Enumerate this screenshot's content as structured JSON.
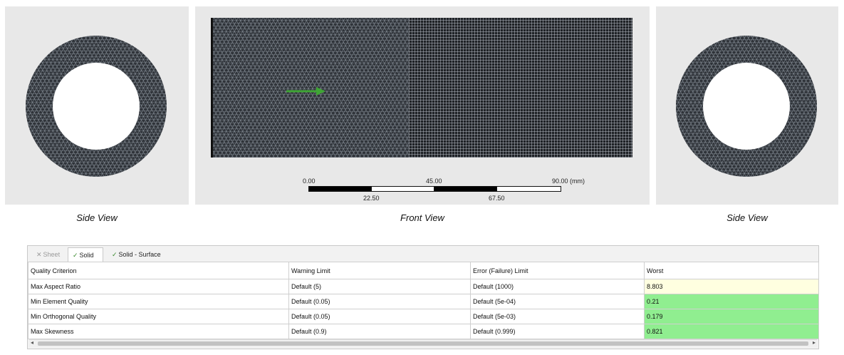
{
  "views": {
    "left_caption": "Side View",
    "front_caption": "Front View",
    "right_caption": "Side View"
  },
  "scale_bar": {
    "top_labels": [
      "0.00",
      "45.00",
      "90.00 (mm)"
    ],
    "bottom_labels": [
      "22.50",
      "67.50"
    ]
  },
  "tabs": [
    {
      "label": "Sheet",
      "icon": "x-icon",
      "state": "disabled"
    },
    {
      "label": "Solid",
      "icon": "check-icon",
      "state": "active"
    },
    {
      "label": "Solid - Surface",
      "icon": "check-icon",
      "state": "normal"
    }
  ],
  "table": {
    "headers": [
      "Quality Criterion",
      "Warning Limit",
      "Error (Failure) Limit",
      "Worst"
    ],
    "rows": [
      [
        "Max Aspect Ratio",
        "Default (5)",
        "Default (1000)",
        "8.803"
      ],
      [
        "Min Element Quality",
        "Default (0.05)",
        "Default (5e-04)",
        "0.21"
      ],
      [
        "Min Orthogonal Quality",
        "Default (0.05)",
        "Default (5e-03)",
        "0.179"
      ],
      [
        "Max Skewness",
        "Default (0.9)",
        "Default (0.999)",
        "0.821"
      ]
    ]
  },
  "colors": {
    "flow_arrow": "#3fa535",
    "worst_warning": "#ffffe0",
    "worst_ok": "#90ee90"
  }
}
